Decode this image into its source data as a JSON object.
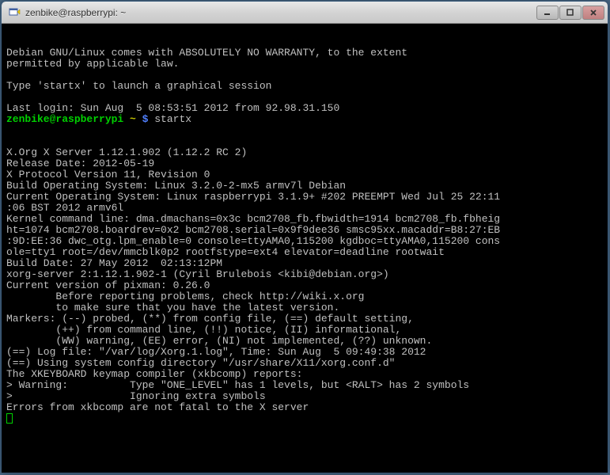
{
  "window": {
    "title": "zenbike@raspberrypi: ~"
  },
  "terminal": {
    "blank_top": [
      "",
      ""
    ],
    "intro": [
      "Debian GNU/Linux comes with ABSOLUTELY NO WARRANTY, to the extent",
      "permitted by applicable law.",
      "",
      "Type 'startx' to launch a graphical session",
      "",
      "Last login: Sun Aug  5 08:53:51 2012 from 92.98.31.150"
    ],
    "prompt": {
      "userhost": "zenbike@raspberrypi",
      "sep": " ~ ",
      "dollar": "$ ",
      "command": "startx"
    },
    "blank_mid": [
      "",
      ""
    ],
    "output": [
      "X.Org X Server 1.12.1.902 (1.12.2 RC 2)",
      "Release Date: 2012-05-19",
      "X Protocol Version 11, Revision 0",
      "Build Operating System: Linux 3.2.0-2-mx5 armv7l Debian",
      "Current Operating System: Linux raspberrypi 3.1.9+ #202 PREEMPT Wed Jul 25 22:11",
      ":06 BST 2012 armv6l",
      "Kernel command line: dma.dmachans=0x3c bcm2708_fb.fbwidth=1914 bcm2708_fb.fbheig",
      "ht=1074 bcm2708.boardrev=0x2 bcm2708.serial=0x9f9dee36 smsc95xx.macaddr=B8:27:EB",
      ":9D:EE:36 dwc_otg.lpm_enable=0 console=ttyAMA0,115200 kgdboc=ttyAMA0,115200 cons",
      "ole=tty1 root=/dev/mmcblk0p2 rootfstype=ext4 elevator=deadline rootwait",
      "Build Date: 27 May 2012  02:13:12PM",
      "xorg-server 2:1.12.1.902-1 (Cyril Brulebois <kibi@debian.org>)",
      "Current version of pixman: 0.26.0",
      "        Before reporting problems, check http://wiki.x.org",
      "        to make sure that you have the latest version.",
      "Markers: (--) probed, (**) from config file, (==) default setting,",
      "        (++) from command line, (!!) notice, (II) informational,",
      "        (WW) warning, (EE) error, (NI) not implemented, (??) unknown.",
      "(==) Log file: \"/var/log/Xorg.1.log\", Time: Sun Aug  5 09:49:38 2012",
      "(==) Using system config directory \"/usr/share/X11/xorg.conf.d\"",
      "The XKEYBOARD keymap compiler (xkbcomp) reports:",
      "> Warning:          Type \"ONE_LEVEL\" has 1 levels, but <RALT> has 2 symbols",
      ">                   Ignoring extra symbols",
      "Errors from xkbcomp are not fatal to the X server"
    ]
  }
}
